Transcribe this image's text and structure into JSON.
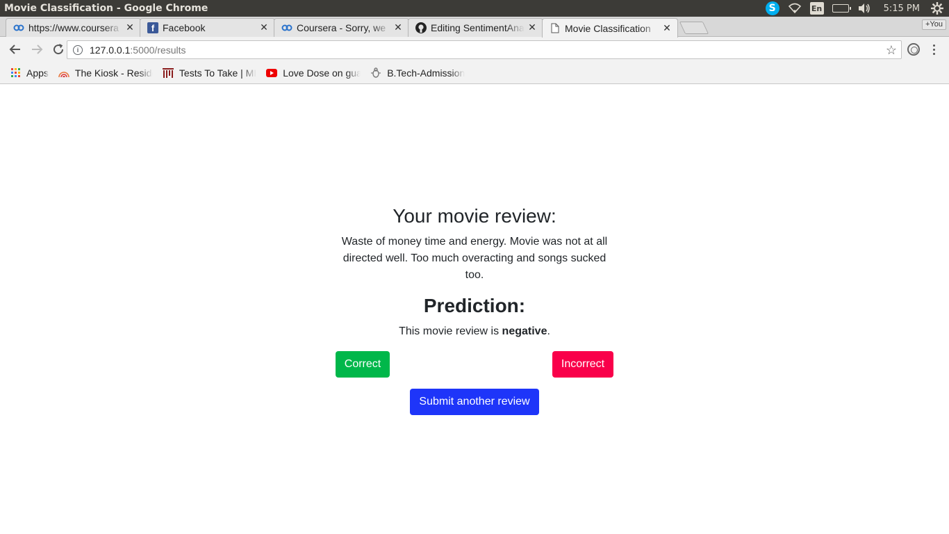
{
  "os": {
    "window_title": "Movie Classification - Google Chrome",
    "lang": "En",
    "clock": "5:15 PM",
    "skype_letter": "S"
  },
  "tabs": [
    {
      "title": "https://www.coursera",
      "icon": "coursera-icon",
      "active": false
    },
    {
      "title": "Facebook",
      "icon": "facebook-icon",
      "active": false
    },
    {
      "title": "Coursera - Sorry, we",
      "icon": "coursera-icon",
      "active": false
    },
    {
      "title": "Editing SentimentAna",
      "icon": "github-icon",
      "active": false
    },
    {
      "title": "Movie Classification",
      "icon": "page-icon",
      "active": true
    }
  ],
  "profile_label": "+You",
  "omnibox": {
    "host": "127.0.0.1",
    "path": ":5000/results"
  },
  "bookmarks": [
    {
      "label": "Apps",
      "icon": "apps-icon"
    },
    {
      "label": "The Kiosk - Reside",
      "icon": "kiosk-icon"
    },
    {
      "label": "Tests To Take | MI",
      "icon": "mit-icon"
    },
    {
      "label": "Love Dose on gua",
      "icon": "youtube-icon"
    },
    {
      "label": "B.Tech-Admission",
      "icon": "bug-icon"
    }
  ],
  "page": {
    "review_heading": "Your movie review:",
    "review_text": "Waste of money time and energy. Movie was not at all directed well. Too much overacting and songs sucked too.",
    "prediction_heading": "Prediction:",
    "prediction_prefix": "This movie review is ",
    "prediction_label": "negative",
    "prediction_suffix": ".",
    "buttons": {
      "correct": "Correct",
      "incorrect": "Incorrect",
      "submit": "Submit another review"
    }
  },
  "colors": {
    "correct": "#00b74a",
    "incorrect": "#f9004a",
    "submit": "#1e35f9"
  }
}
